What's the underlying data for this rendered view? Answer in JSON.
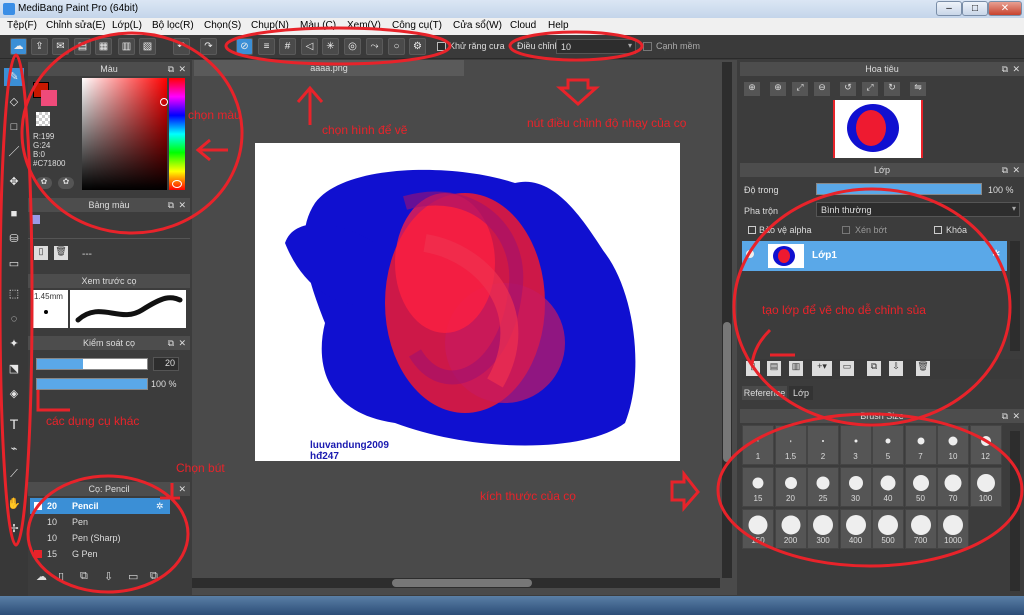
{
  "window": {
    "title": "MediBang Paint Pro (64bit)",
    "minimize": "–",
    "maximize": "□",
    "close": "✕"
  },
  "menu": [
    "Tệp(F)",
    "Chỉnh sửa(E)",
    "Lớp(L)",
    "Bộ lọc(R)",
    "Chọn(S)",
    "Chụp(N)",
    "Màu (C)",
    "Xem(V)",
    "Công cụ(T)",
    "Cửa sổ(W)",
    "Cloud",
    "Help"
  ],
  "toolbar": {
    "anti_alias_label": "Khử răng cưa",
    "adjust_label": "Điều chỉnh",
    "adjust_value": "10",
    "soft_edge_label": "Cạnh mềm"
  },
  "panels": {
    "color": {
      "title": "Màu",
      "rgb": {
        "r": "R:199",
        "g": "G:24",
        "b": "B:0",
        "hex": "#C71800"
      }
    },
    "palette": {
      "title": "Bảng màu",
      "row_label": "---"
    },
    "brush_preview": {
      "title": "Xem trước cọ",
      "size": "1.45mm"
    },
    "brush_control": {
      "title": "Kiểm soát cọ",
      "size_value": "20",
      "opacity_value": "100 %",
      "size_fraction": 0.42,
      "opacity_fraction": 1.0
    },
    "brushes": {
      "title": "Cọ: Pencil",
      "items": [
        {
          "size": "20",
          "name": "Pencil"
        },
        {
          "size": "10",
          "name": "Pen"
        },
        {
          "size": "10",
          "name": "Pen (Sharp)"
        },
        {
          "size": "15",
          "name": "G Pen"
        }
      ]
    },
    "navigator": {
      "title": "Hoa tiêu"
    },
    "layers": {
      "title": "Lớp",
      "opacity_label": "Độ trong",
      "opacity_value": "100 %",
      "blend_label": "Pha trộn",
      "blend_value": "Bình thường",
      "protect_alpha": "Bảo vệ alpha",
      "clipping": "Xén bớt",
      "lock": "Khóa",
      "layer_name": "Lớp1"
    },
    "tabs": {
      "reference": "Reference",
      "layer": "Lớp"
    },
    "brush_size": {
      "title": "Brush Size",
      "sizes": [
        "1",
        "1.5",
        "2",
        "3",
        "5",
        "7",
        "10",
        "12",
        "15",
        "20",
        "25",
        "30",
        "40",
        "50",
        "70",
        "100",
        "150",
        "200",
        "300",
        "400",
        "500",
        "700",
        "1000"
      ]
    }
  },
  "document": {
    "tab_name": "aaaa.png",
    "signature_line1": "luuvandung2009",
    "signature_line2": "hđ247"
  },
  "annotations": {
    "choose_color": "chọn màu",
    "choose_drawing_shape": "chọn hình để vẽ",
    "sensitivity": "nút điều chỉnh độ nhạy của cọ",
    "other_tools": "các dụng cụ khác",
    "choose_brush": "Chọn bút",
    "new_layer": "tạo lớp để vẽ cho dễ chỉnh sủa",
    "brush_size": "kích thước của cọ"
  },
  "colors": {
    "accent": "#3b8fd6",
    "annotation": "#e8232a",
    "paint_blue": "#1010d0",
    "paint_red": "#ee1a30"
  }
}
